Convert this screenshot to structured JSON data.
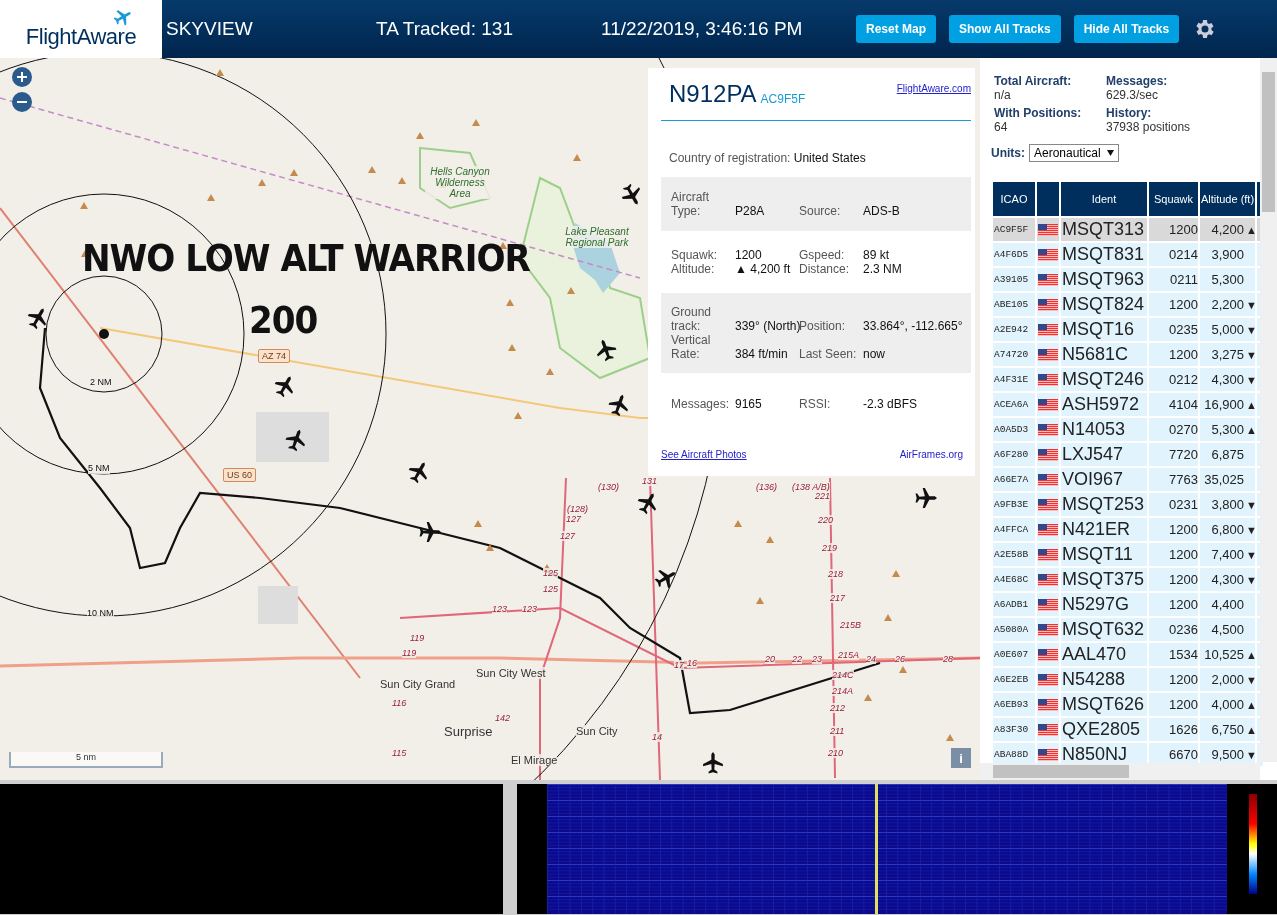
{
  "header": {
    "logo": "FlightAware",
    "title": "SKYVIEW",
    "tracked": "TA Tracked: 131",
    "datetime": "11/22/2019, 3:46:16 PM",
    "buttons": [
      "Reset Map",
      "Show All Tracks",
      "Hide All Tracks"
    ]
  },
  "map": {
    "overlay_title": "NWO LOW ALT WARRIOR",
    "overlay_subtitle": "200",
    "range_rings": [
      "2 NM",
      "5 NM",
      "10 NM"
    ],
    "highways": [
      "AZ 74",
      "US 60"
    ],
    "places": [
      "Hells Canyon Wilderness Area",
      "Lake Pleasant Regional Park",
      "Sun City Grand",
      "Sun City West",
      "Surprise",
      "Sun City",
      "El Mirage"
    ],
    "road_numbers": [
      "(130)",
      "(128)",
      "127",
      "127",
      "125",
      "125",
      "123",
      "123",
      "119",
      "119",
      "116",
      "115",
      "142",
      "14",
      "131",
      "(136)",
      "(138 A/B)",
      "221",
      "220",
      "219",
      "218",
      "217",
      "215B",
      "215A",
      "214C",
      "214A",
      "212",
      "211",
      "210",
      "17",
      "16",
      "20",
      "22",
      "23",
      "24",
      "26",
      "28"
    ],
    "scale": "5 nm",
    "info_button": "i"
  },
  "popup": {
    "ident": "N912PA",
    "icao": "AC9F5F",
    "link": "FlightAware.com",
    "country_label": "Country of registration:",
    "country": "United States",
    "sections": [
      {
        "shaded": true,
        "rows": [
          [
            {
              "label": "Aircraft Type:",
              "value": "P28A"
            },
            {
              "label": "Source:",
              "value": "ADS-B"
            }
          ]
        ]
      },
      {
        "shaded": false,
        "rows": [
          [
            {
              "label": "Squawk:",
              "value": "1200"
            },
            {
              "label": "Gspeed:",
              "value": "89 kt"
            }
          ],
          [
            {
              "label": "Altitude:",
              "value": "▲ 4,200 ft"
            },
            {
              "label": "Distance:",
              "value": "2.3 NM"
            }
          ]
        ]
      },
      {
        "shaded": true,
        "rows": [
          [
            {
              "label": "Ground track:",
              "value": "339° (North)"
            },
            {
              "label": "Position:",
              "value": "33.864°, -112.665°"
            }
          ],
          [
            {
              "label": "Vertical Rate:",
              "value": "384 ft/min"
            },
            {
              "label": "Last Seen:",
              "value": "now"
            }
          ]
        ]
      },
      {
        "shaded": false,
        "rows": [
          [
            {
              "label": "Messages:",
              "value": "9165"
            },
            {
              "label": "RSSI:",
              "value": "-2.3 dBFS"
            }
          ]
        ]
      }
    ],
    "photos_link": "See Aircraft Photos",
    "airframes_link": "AirFrames.org"
  },
  "stats": [
    {
      "label": "Total Aircraft:",
      "value": "n/a"
    },
    {
      "label": "Messages:",
      "value": "629.3/sec"
    },
    {
      "label": "With Positions:",
      "value": "64"
    },
    {
      "label": "History:",
      "value": "37938 positions"
    }
  ],
  "units": {
    "label": "Units:",
    "value": "Aeronautical"
  },
  "table": {
    "columns": [
      "ICAO",
      "Ident",
      "Squawk",
      "Altitude (ft)"
    ],
    "rows": [
      {
        "icao": "AC9F5F",
        "ident": "MSQT313",
        "squawk": "1200",
        "altitude": "4,200",
        "trend": "▲",
        "selected": true
      },
      {
        "icao": "A4F6D5",
        "ident": "MSQT831",
        "squawk": "0214",
        "altitude": "3,900",
        "selected": false
      },
      {
        "icao": "A39105",
        "ident": "MSQT963",
        "squawk": "0211",
        "altitude": "5,300",
        "selected": false
      },
      {
        "icao": "ABE105",
        "ident": "MSQT824",
        "squawk": "1200",
        "altitude": "2,200",
        "trend": "▼",
        "selected": false
      },
      {
        "icao": "A2E942",
        "ident": "MSQT16",
        "squawk": "0235",
        "altitude": "5,000",
        "trend": "▼",
        "selected": false
      },
      {
        "icao": "A74720",
        "ident": "N5681C",
        "squawk": "1200",
        "altitude": "3,275",
        "trend": "▼",
        "selected": false
      },
      {
        "icao": "A4F31E",
        "ident": "MSQT246",
        "squawk": "0212",
        "altitude": "4,300",
        "trend": "▼",
        "selected": false
      },
      {
        "icao": "ACEA6A",
        "ident": "ASH5972",
        "squawk": "4104",
        "altitude": "16,900",
        "trend": "▲",
        "selected": false
      },
      {
        "icao": "A0A5D3",
        "ident": "N14053",
        "squawk": "0270",
        "altitude": "5,300",
        "trend": "▲",
        "selected": false
      },
      {
        "icao": "A6F280",
        "ident": "LXJ547",
        "squawk": "7720",
        "altitude": "6,875",
        "selected": false
      },
      {
        "icao": "A66E7A",
        "ident": "VOI967",
        "squawk": "7763",
        "altitude": "35,025",
        "selected": false
      },
      {
        "icao": "A9FB3E",
        "ident": "MSQT253",
        "squawk": "0231",
        "altitude": "3,800",
        "trend": "▼",
        "selected": false
      },
      {
        "icao": "A4FFCA",
        "ident": "N421ER",
        "squawk": "1200",
        "altitude": "6,800",
        "trend": "▼",
        "selected": false
      },
      {
        "icao": "A2E58B",
        "ident": "MSQT11",
        "squawk": "1200",
        "altitude": "7,400",
        "trend": "▼",
        "selected": false
      },
      {
        "icao": "A4E68C",
        "ident": "MSQT375",
        "squawk": "1200",
        "altitude": "4,300",
        "trend": "▼",
        "selected": false
      },
      {
        "icao": "A6ADB1",
        "ident": "N5297G",
        "squawk": "1200",
        "altitude": "4,400",
        "selected": false
      },
      {
        "icao": "A5080A",
        "ident": "MSQT632",
        "squawk": "0236",
        "altitude": "4,500",
        "selected": false
      },
      {
        "icao": "A0E607",
        "ident": "AAL470",
        "squawk": "1534",
        "altitude": "10,525",
        "trend": "▲",
        "selected": false
      },
      {
        "icao": "A6E2EB",
        "ident": "N54288",
        "squawk": "1200",
        "altitude": "2,000",
        "trend": "▼",
        "selected": false
      },
      {
        "icao": "A6EB93",
        "ident": "MSQT626",
        "squawk": "1200",
        "altitude": "4,000",
        "trend": "▲",
        "selected": false
      },
      {
        "icao": "A83F30",
        "ident": "QXE2805",
        "squawk": "1626",
        "altitude": "6,750",
        "trend": "▲",
        "selected": false
      },
      {
        "icao": "ABA88D",
        "ident": "N850NJ",
        "squawk": "6670",
        "altitude": "9,500",
        "trend": "▼",
        "selected": false
      }
    ]
  }
}
